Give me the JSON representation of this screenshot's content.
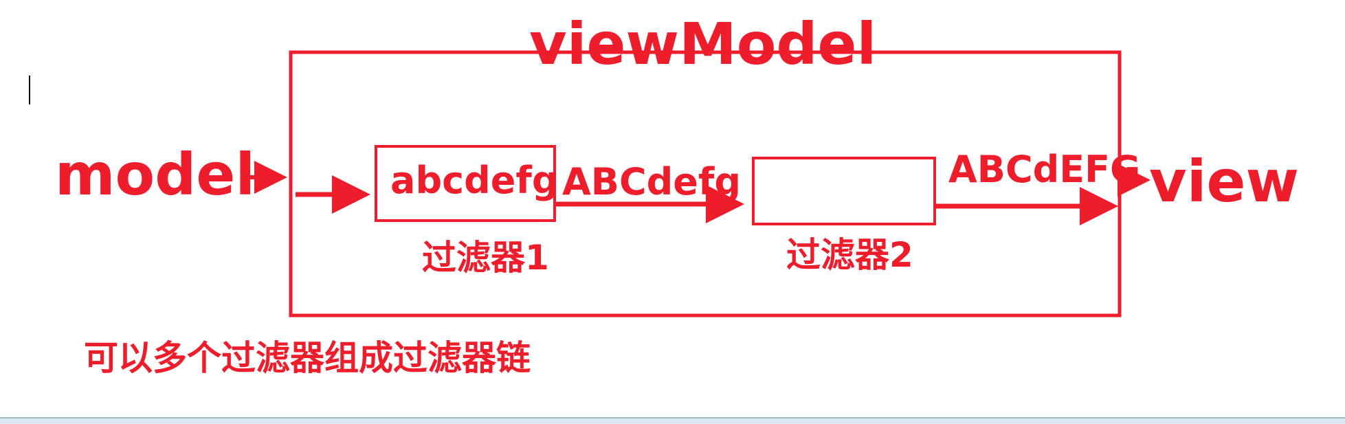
{
  "diagram": {
    "container_label": "viewModel",
    "input_label": "model",
    "output_label": "view",
    "filter1": {
      "content": "abcdefg",
      "caption": "过滤器1"
    },
    "filter2": {
      "content": "",
      "caption": "过滤器2"
    },
    "edge_labels": {
      "after_filter1": "ABCdefg",
      "after_filter2": "ABCdEFG"
    },
    "note": "可以多个过滤器组成过滤器链"
  },
  "colors": {
    "accent": "#ee1d2c",
    "cursor": "#000000",
    "bottom_strip": "#dbe9ef"
  }
}
